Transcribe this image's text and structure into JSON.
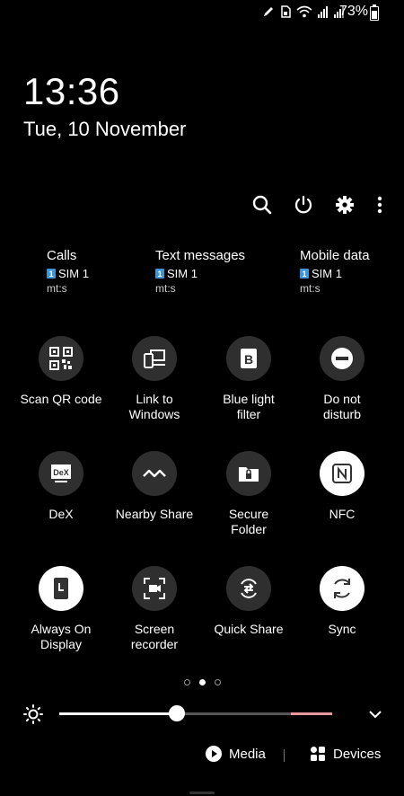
{
  "status_bar": {
    "battery_percent": "73%",
    "icons": [
      "pen-icon",
      "sim-icon",
      "wifi-icon",
      "signal-icon",
      "signal-icon"
    ]
  },
  "lock": {
    "time": "13:36",
    "date": "Tue, 10 November"
  },
  "top_actions": [
    "search-icon",
    "power-icon",
    "gear-icon",
    "more-icon"
  ],
  "sims": [
    {
      "title": "Calls",
      "sim_badge": "1",
      "sim_label": "SIM 1",
      "carrier": "mt:s"
    },
    {
      "title": "Text messages",
      "sim_badge": "1",
      "sim_label": "SIM 1",
      "carrier": "mt:s"
    },
    {
      "title": "Mobile data",
      "sim_badge": "1",
      "sim_label": "SIM 1",
      "carrier": "mt:s"
    }
  ],
  "tiles": [
    {
      "label": "Scan QR code",
      "icon": "qr-code-icon",
      "on": false
    },
    {
      "label": "Link to\nWindows",
      "icon": "link-to-windows-icon",
      "on": false
    },
    {
      "label": "Blue light\nfilter",
      "icon": "blue-light-icon",
      "on": false
    },
    {
      "label": "Do not\ndisturb",
      "icon": "do-not-disturb-icon",
      "on": false
    },
    {
      "label": "DeX",
      "icon": "dex-icon",
      "on": false
    },
    {
      "label": "Nearby Share",
      "icon": "nearby-share-icon",
      "on": false
    },
    {
      "label": "Secure\nFolder",
      "icon": "secure-folder-icon",
      "on": false
    },
    {
      "label": "NFC",
      "icon": "nfc-icon",
      "on": true
    },
    {
      "label": "Always On\nDisplay",
      "icon": "always-on-display-icon",
      "on": true
    },
    {
      "label": "Screen\nrecorder",
      "icon": "screen-recorder-icon",
      "on": false
    },
    {
      "label": "Quick Share",
      "icon": "quick-share-icon",
      "on": false
    },
    {
      "label": "Sync",
      "icon": "sync-icon",
      "on": true
    }
  ],
  "pager": {
    "pages": 3,
    "active": 1
  },
  "brightness": {
    "level": 0.43
  },
  "bottom": {
    "media_label": "Media",
    "devices_label": "Devices"
  },
  "colors": {
    "background": "#000000",
    "tile_off": "#2f2f2f",
    "tile_on": "#ffffff",
    "sim_badge": "#3b95d6"
  }
}
